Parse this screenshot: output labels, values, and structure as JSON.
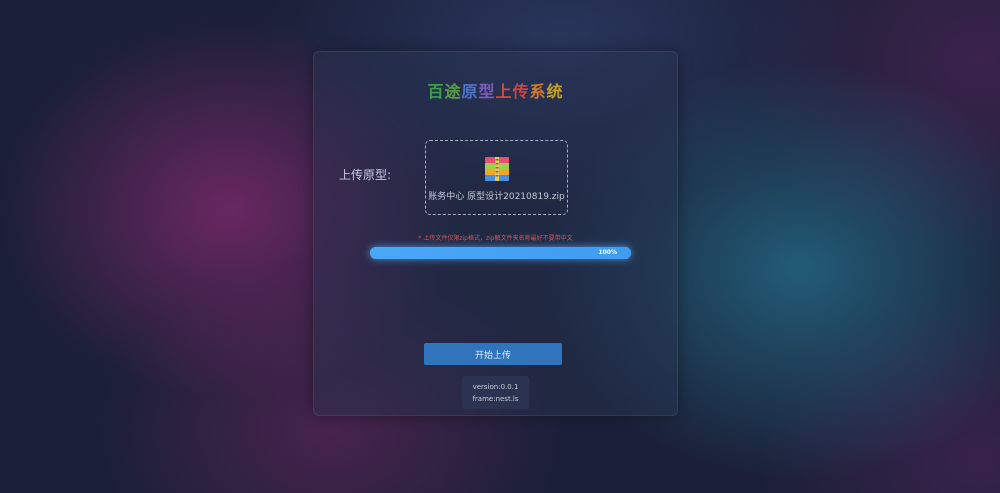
{
  "title": {
    "chars": [
      "百",
      "途",
      "原",
      "型",
      "上",
      "传",
      "系",
      "统"
    ],
    "colors": [
      "#3fa04a",
      "#5b9f45",
      "#4e74c8",
      "#7d5fbf",
      "#d24a3e",
      "#c6484a",
      "#d37a2e",
      "#c7a021"
    ]
  },
  "upload": {
    "label": "上传原型:",
    "file_icon": "zip-archive-icon",
    "file_name": "账务中心 原型设计20210819.zip"
  },
  "hint": "* 上传文件仅限zip格式，zip解文件夹名称最好不要带中文",
  "progress": {
    "value": 1.0,
    "label": "100%"
  },
  "actions": {
    "start_label": "开始上传"
  },
  "footer": {
    "version": "version:0.0.1",
    "frame": "frame:nest.ls"
  },
  "colors": {
    "accent": "#3f9cf2",
    "button": "#2f74bd",
    "hint": "#d05a5a"
  }
}
